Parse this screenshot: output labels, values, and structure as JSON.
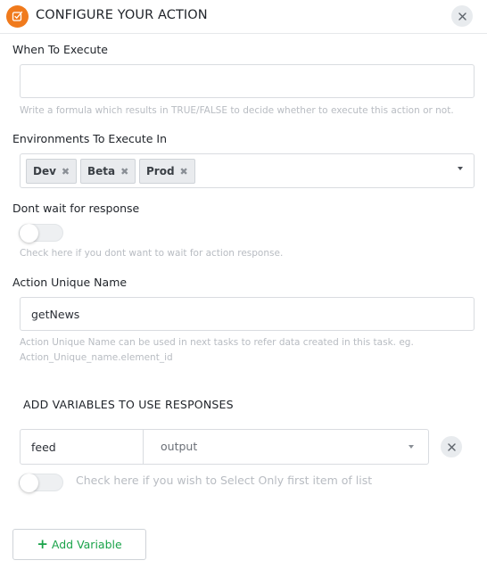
{
  "header": {
    "title": "CONFIGURE YOUR ACTION",
    "icon": "edit-checkbox-icon",
    "icon_color": "#f07a1c"
  },
  "when_to_execute": {
    "label": "When To Execute",
    "value": "",
    "help": "Write a formula which results in TRUE/FALSE to decide whether to execute this action or not."
  },
  "environments": {
    "label": "Environments To Execute In",
    "chips": [
      "Dev",
      "Beta",
      "Prod"
    ],
    "remove_glyph": "✖"
  },
  "dont_wait": {
    "label": "Dont wait for response",
    "enabled": false,
    "help": "Check here if you dont want to wait for action response."
  },
  "unique_name": {
    "label": "Action Unique Name",
    "value": "getNews",
    "help_line1": "Action Unique Name can be used in next tasks to refer data created in this task. eg.",
    "help_line2": "Action_Unique_name.element_id"
  },
  "variables": {
    "section_title": "ADD VARIABLES TO USE RESPONSES",
    "rows": [
      {
        "name": "feed",
        "source": "output",
        "first_item_only": false
      }
    ],
    "first_item_help": "Check here if you wish to Select Only first item of list",
    "add_label": "Add Variable",
    "accent_color": "#1aa34a"
  }
}
